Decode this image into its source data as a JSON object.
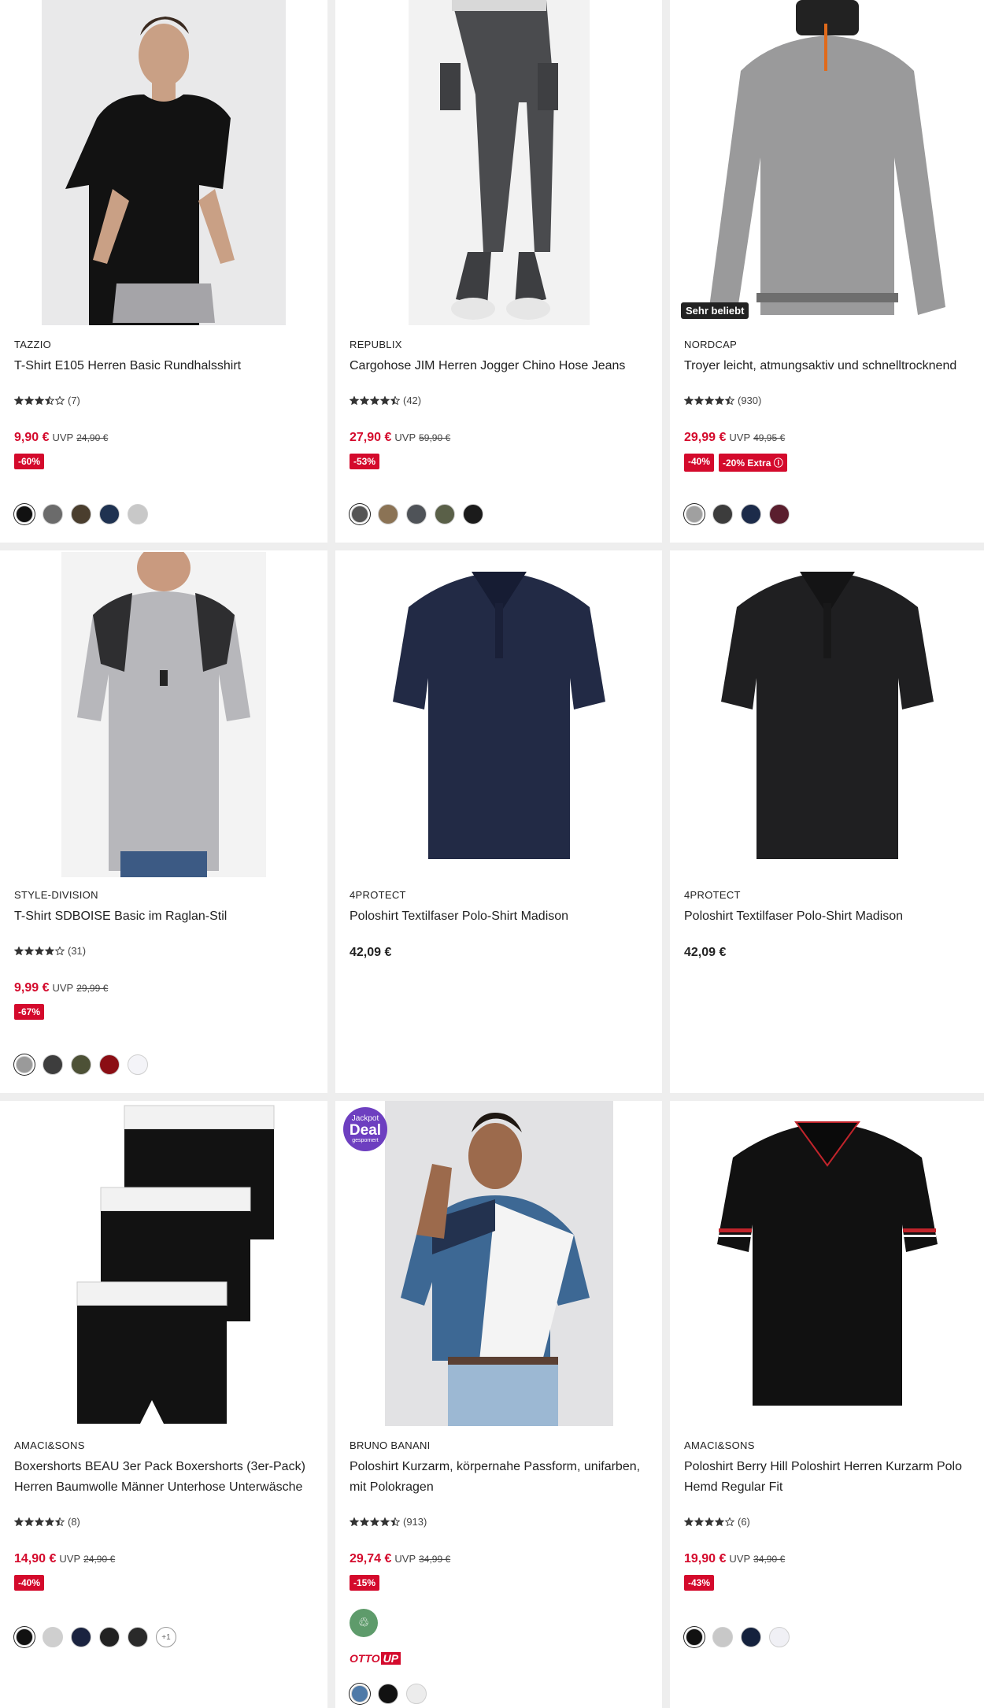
{
  "colors": {
    "sale_red": "#d40a2c",
    "text": "#222222",
    "page_bg": "#eeeeee"
  },
  "products": [
    {
      "brand": "TAZZIO",
      "title": "T-Shirt E105 Herren Basic Rundhalsshirt",
      "rating": 3.5,
      "review_count": "(7)",
      "price": "9,90 €",
      "uvp_label": "UVP",
      "old_price": "24,90 €",
      "tags": [
        "-60%"
      ],
      "swatches": [
        "#111111",
        "#6b6b6b",
        "#4a3e2e",
        "#1f3251",
        "#c8c8c8"
      ],
      "image": "black-tshirt-model"
    },
    {
      "brand": "REPUBLIX",
      "title": "Cargohose JIM Herren Jogger Chino Hose Jeans",
      "rating": 4.5,
      "review_count": "(42)",
      "price": "27,90 €",
      "uvp_label": "UVP",
      "old_price": "59,90 €",
      "tags": [
        "-53%"
      ],
      "swatches": [
        "#555555",
        "#8b7355",
        "#4f5358",
        "#5a6048",
        "#1b1b1b"
      ],
      "image": "grey-cargo-pants"
    },
    {
      "brand": "NORDCAP",
      "title": "Troyer leicht, atmungsaktiv und schnelltrocknend",
      "rating": 4.5,
      "review_count": "(930)",
      "price": "29,99 €",
      "uvp_label": "UVP",
      "old_price": "49,95 €",
      "tags": [
        "-40%",
        "-20% Extra ⓘ"
      ],
      "badge": "Sehr beliebt",
      "swatches": [
        "#a0a0a0",
        "#3c3c3c",
        "#1c2b4a",
        "#5a1e2e"
      ],
      "image": "grey-troyer-sweater"
    },
    {
      "brand": "STYLE-DIVISION",
      "title": "T-Shirt SDBOISE Basic im Raglan-Stil",
      "rating": 4,
      "review_count": "(31)",
      "price": "9,99 €",
      "uvp_label": "UVP",
      "old_price": "29,99 €",
      "tags": [
        "-67%"
      ],
      "swatches": [
        "#9a9a9a",
        "#3d3d3d",
        "#4d5136",
        "#8b0e14",
        "#f4f4f8"
      ],
      "image": "raglan-tshirt-model"
    },
    {
      "brand": "4PROTECT",
      "title": "Poloshirt Textilfaser Polo-Shirt Madison",
      "price": "42,09 €",
      "image": "navy-polo"
    },
    {
      "brand": "4PROTECT",
      "title": "Poloshirt Textilfaser Polo-Shirt Madison",
      "price": "42,09 €",
      "image": "black-polo"
    },
    {
      "brand": "AMACI&SONS",
      "title": "Boxershorts BEAU 3er Pack Boxershorts (3er-Pack) Herren Baumwolle Männer Unterhose Unterwäsche",
      "rating": 4.5,
      "review_count": "(8)",
      "price": "14,90 €",
      "uvp_label": "UVP",
      "old_price": "24,90 €",
      "tags": [
        "-40%"
      ],
      "swatches": [
        "#111111",
        "#cfcfcf",
        "#1a2340",
        "#222222",
        "#2a2a2a"
      ],
      "more_swatches": "+1",
      "image": "black-boxershorts-3pack"
    },
    {
      "brand": "BRUNO BANANI",
      "title": "Poloshirt Kurzarm, körpernahe Passform, unifarben, mit Polokragen",
      "rating": 4.5,
      "review_count": "(913)",
      "price": "29,74 €",
      "uvp_label": "UVP",
      "old_price": "34,99 €",
      "tags": [
        "-15%"
      ],
      "jackpot": {
        "line1": "Jackpot",
        "line2": "Deal",
        "line3": "gespornert"
      },
      "otto_up": {
        "otto": "OTTO",
        "up": "UP"
      },
      "swatches": [
        "#4f7aa8",
        "#111111",
        "#ececec"
      ],
      "image": "blue-polo-model"
    },
    {
      "brand": "AMACI&SONS",
      "title": "Poloshirt Berry Hill Poloshirt Herren Kurzarm Polo Hemd Regular Fit",
      "rating": 4,
      "review_count": "(6)",
      "price": "19,90 €",
      "uvp_label": "UVP",
      "old_price": "34,90 €",
      "tags": [
        "-43%"
      ],
      "swatches": [
        "#111111",
        "#c8c8c8",
        "#14213d",
        "#f0f0f5"
      ],
      "image": "black-polo-tipped"
    }
  ]
}
